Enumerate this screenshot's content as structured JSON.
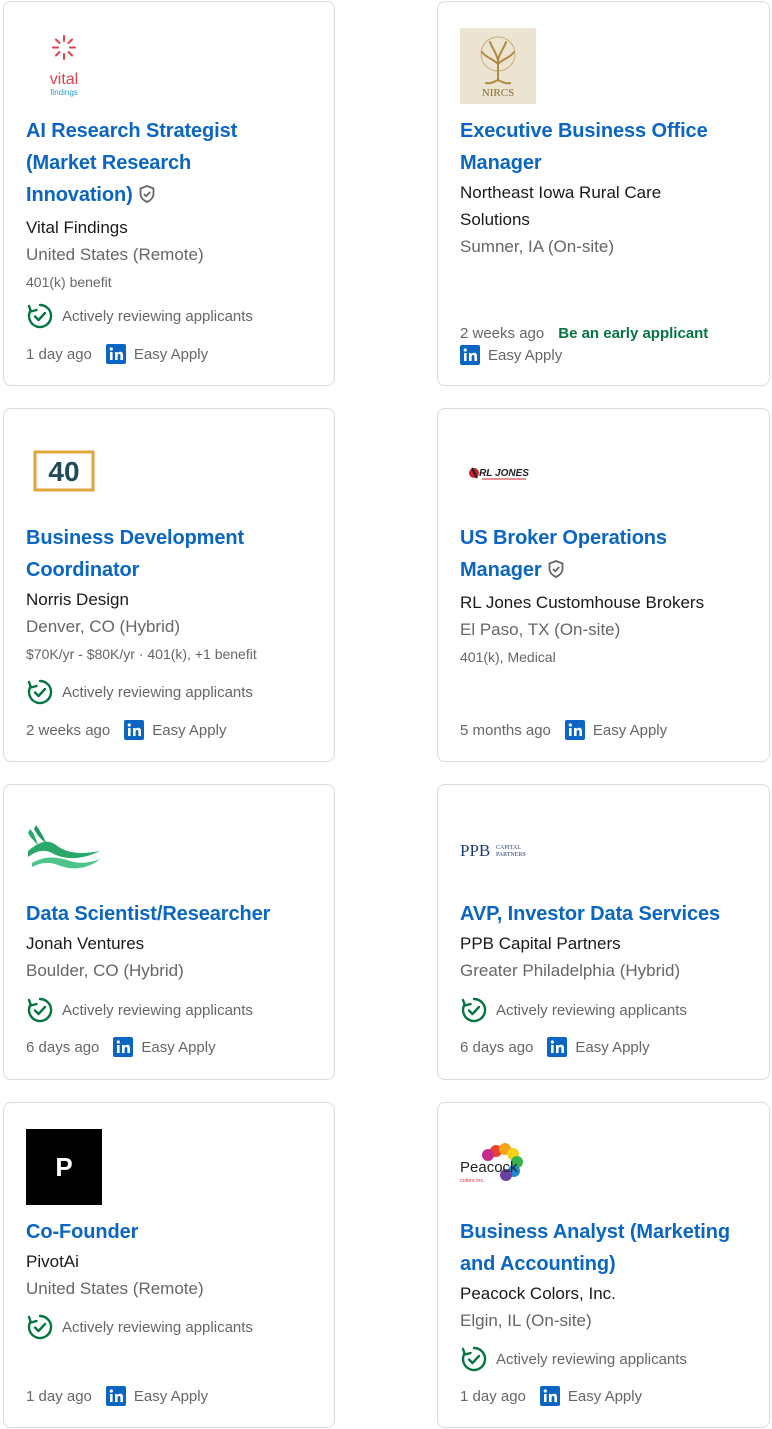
{
  "colors": {
    "link": "#0a66c2",
    "green": "#057642",
    "muted": "#666666"
  },
  "insight_label": "Actively reviewing applicants",
  "easy_apply_label": "Easy Apply",
  "jobs": [
    {
      "logo": "vital-findings-logo",
      "logo_text": [
        "vital",
        "findings"
      ],
      "title_lines": [
        "AI Research Strategist",
        "(Market Research",
        "Innovation)"
      ],
      "verified": true,
      "company": "Vital Findings",
      "location": "United States (Remote)",
      "benefits": "401(k) benefit",
      "insight": true,
      "posted": "1 day ago",
      "early": "",
      "easy_apply": true
    },
    {
      "logo": "nircs-logo",
      "logo_text": [
        "NIRCS"
      ],
      "title_lines": [
        "Executive Business Office",
        "Manager"
      ],
      "verified": false,
      "company_lines": [
        "Northeast Iowa Rural Care",
        "Solutions"
      ],
      "location": "Sumner, IA (On-site)",
      "benefits": "",
      "insight": false,
      "posted": "2 weeks ago",
      "early": "Be an early applicant",
      "easy_apply": true
    },
    {
      "logo": "forty-logo",
      "logo_text": [
        "40"
      ],
      "title_lines": [
        "Business Development",
        "Coordinator"
      ],
      "verified": false,
      "company": "Norris Design",
      "location": "Denver, CO (Hybrid)",
      "benefits": "$70K/yr - $80K/yr · 401(k), +1 benefit",
      "insight": true,
      "posted": "2 weeks ago",
      "early": "",
      "easy_apply": true
    },
    {
      "logo": "rl-jones-logo",
      "logo_text": [
        "RL JONES"
      ],
      "title_lines": [
        "US Broker Operations",
        "Manager"
      ],
      "verified": true,
      "company": "RL Jones Customhouse Brokers",
      "location": "El Paso, TX (On-site)",
      "benefits": "401(k), Medical",
      "insight": false,
      "posted": "5 months ago",
      "early": "",
      "easy_apply": true
    },
    {
      "logo": "jonah-ventures-logo",
      "logo_text": [],
      "title_lines": [
        "Data Scientist/Researcher"
      ],
      "verified": false,
      "company": "Jonah Ventures",
      "location": "Boulder, CO (Hybrid)",
      "benefits": "",
      "insight": true,
      "posted": "6 days ago",
      "early": "",
      "easy_apply": true
    },
    {
      "logo": "ppb-capital-logo",
      "logo_text": [
        "PPB",
        "CAPITAL",
        "PARTNERS"
      ],
      "title_lines": [
        "AVP, Investor Data Services"
      ],
      "verified": false,
      "company": "PPB Capital Partners",
      "location": "Greater Philadelphia (Hybrid)",
      "benefits": "",
      "insight": true,
      "posted": "6 days ago",
      "early": "",
      "easy_apply": true
    },
    {
      "logo": "pivotai-logo",
      "logo_text": [
        "P"
      ],
      "title_lines": [
        "Co-Founder"
      ],
      "verified": false,
      "company": "PivotAi",
      "location": "United States (Remote)",
      "benefits": "",
      "insight": true,
      "posted": "1 day ago",
      "early": "",
      "easy_apply": true
    },
    {
      "logo": "peacock-colors-logo",
      "logo_text": [
        "Peacock",
        "colors inc."
      ],
      "title_lines": [
        "Business Analyst (Marketing",
        "and Accounting)"
      ],
      "verified": false,
      "company": "Peacock Colors, Inc.",
      "location": "Elgin, IL (On-site)",
      "benefits": "",
      "insight": true,
      "posted": "1 day ago",
      "early": "",
      "easy_apply": true
    }
  ]
}
